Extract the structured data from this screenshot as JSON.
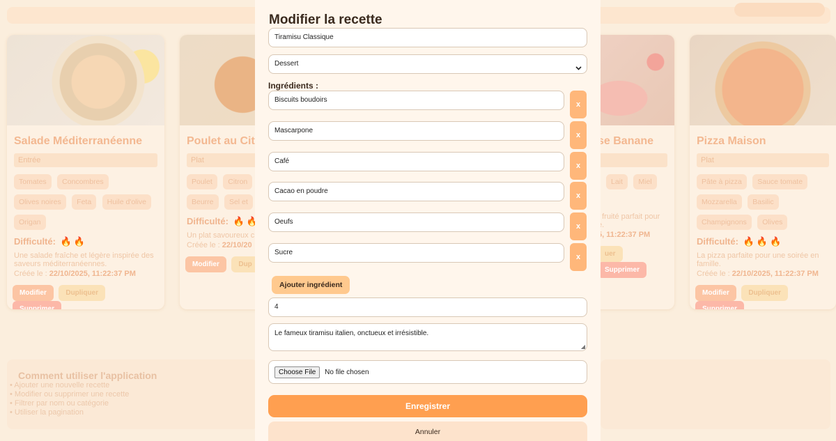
{
  "background": {
    "cards": [
      {
        "title": "Salade Méditerranéenne",
        "category": "Entrée",
        "ingredients": [
          "Tomates",
          "Concombres",
          "Olives noires",
          "Feta",
          "Huile d'olive",
          "Origan"
        ],
        "difficulty_label": "Difficulté:",
        "difficulty_level": 2,
        "description": "Une salade fraîche et légère inspirée des saveurs méditerranéennes.",
        "created_label": "Créée le :",
        "created_date": "22/10/2025, 11:22:37 PM",
        "buttons": {
          "edit": "Modifier",
          "duplicate": "Dupliquer",
          "delete": "Supprimer"
        }
      },
      {
        "title": "Poulet au Cit",
        "category": "Plat",
        "ingredients": [
          "Poulet",
          "Citron",
          "Beurre",
          "Sel et"
        ],
        "difficulty_label": "Difficulté:",
        "difficulty_level": 2,
        "description": "Un plat savoureux citron pour un repa",
        "created_label": "Créée le :",
        "created_date": "22/10/20",
        "buttons": {
          "edit": "Modifier",
          "duplicate": "Dup"
        }
      },
      {
        "title": "se Banane",
        "ingredients": [
          "Lait",
          "Miel"
        ],
        "description": "t fruité parfait pour e.",
        "created_date": "5, 11:22:37 PM",
        "buttons": {
          "duplicate": "uer",
          "delete": "Supprimer"
        }
      },
      {
        "title": "Pizza Maison",
        "category": "Plat",
        "ingredients": [
          "Pâte à pizza",
          "Sauce tomate",
          "Mozzarella",
          "Basilic",
          "Champignons",
          "Olives"
        ],
        "difficulty_label": "Difficulté:",
        "difficulty_level": 3,
        "description": "La pizza parfaite pour une soirée en famille.",
        "created_label": "Créée le :",
        "created_date": "22/10/2025, 11:22:37 PM",
        "buttons": {
          "edit": "Modifier",
          "duplicate": "Dupliquer",
          "delete": "Supprimer"
        }
      }
    ],
    "help": {
      "title": "Comment utiliser l'application",
      "items": [
        "Ajouter une nouvelle recette",
        "Modifier ou supprimer une recette",
        "Filtrer par nom ou catégorie",
        "Utiliser la pagination"
      ]
    }
  },
  "modal": {
    "title": "Modifier la recette",
    "name_value": "Tiramisu Classique",
    "category_value": "Dessert",
    "ingredients_label": "Ingrédients :",
    "ingredients": [
      "Biscuits boudoirs",
      "Mascarpone",
      "Café",
      "Cacao en poudre",
      "Oeufs",
      "Sucre"
    ],
    "remove_label": "x",
    "add_ingredient_label": "Ajouter ingrédient",
    "difficulty_value": "4",
    "description_value": "Le fameux tiramisu italien, onctueux et irrésistible.",
    "file_button": "Choose File",
    "file_status": "No file chosen",
    "save_label": "Enregistrer",
    "cancel_label": "Annuler"
  },
  "colors": {
    "accent": "#ff9f50",
    "accent_light": "#ffc98e",
    "remove_button": "#ffb77a",
    "overlay": "#fbeedd"
  },
  "icons": {
    "difficulty": "flame-icon",
    "select": "chevron-down-icon"
  }
}
